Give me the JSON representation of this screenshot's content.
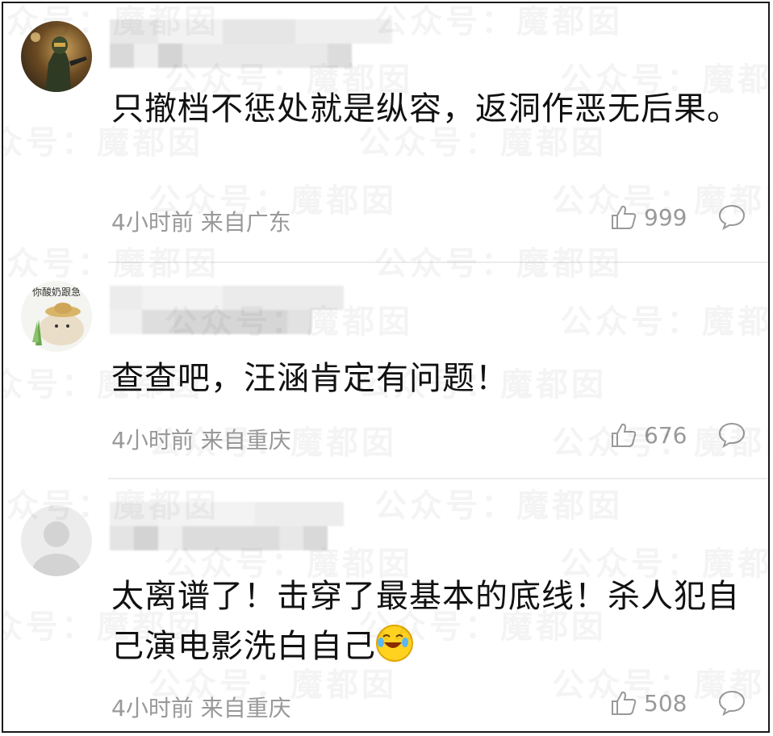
{
  "comments": [
    {
      "text": "只撤档不惩处就是纵容，返洞作恶无后果。",
      "time": "4小时前",
      "location": "来自广东",
      "likes": "999",
      "avatar": "armored-soldier-avatar"
    },
    {
      "text": "查查吧，汪涵肯定有问题！",
      "time": "4小时前",
      "location": "来自重庆",
      "likes": "676",
      "avatar": "cat-meme-avatar",
      "avatar_caption": "你酸奶跟急"
    },
    {
      "text": "太离谱了！击穿了最基本的底线！杀人犯自己演电影洗白自己",
      "time": "4小时前",
      "location": "来自重庆",
      "likes": "508",
      "avatar": "default-user-avatar",
      "emoji": "laughing-crying-emoji"
    }
  ],
  "watermark": "公众号：魔都囡",
  "colors": {
    "text": "#111111",
    "meta": "#999999",
    "divider": "#ececec"
  }
}
